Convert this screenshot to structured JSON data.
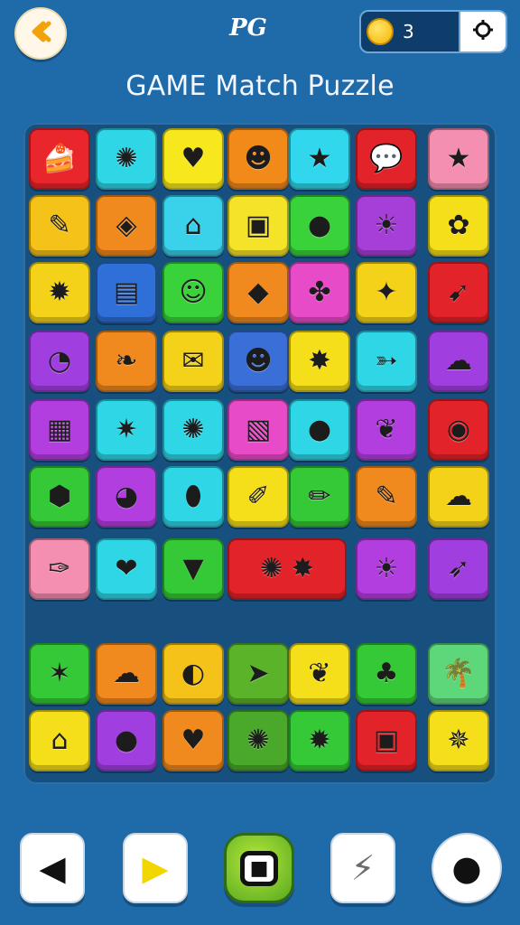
{
  "header": {
    "level": "PG",
    "coins": "3",
    "title": "GAME Match Puzzle"
  },
  "icons": {
    "back": "back-arrow-icon",
    "settings": "gear-icon",
    "coin": "coin-icon"
  },
  "toolbar": [
    {
      "name": "previous-button",
      "icon": "left-triangle-icon",
      "glyph": "◀",
      "color": "#111111"
    },
    {
      "name": "play-button",
      "icon": "play-icon",
      "glyph": "▶",
      "color": "#f2d600"
    },
    {
      "name": "center-action-button",
      "icon": "square-target-icon",
      "glyph": "■",
      "color": "#111111"
    },
    {
      "name": "wand-button",
      "icon": "wand-icon",
      "glyph": "⚡",
      "color": "#6b6b6b"
    },
    {
      "name": "bomb-button",
      "icon": "bomb-icon",
      "glyph": "●",
      "color": "#111111"
    }
  ],
  "tiles": [
    [
      {
        "bg": "#e8262b",
        "icon": "cake-icon",
        "glyph": "🍰"
      },
      {
        "bg": "#2fd6e6",
        "icon": "green-monster-icon",
        "glyph": "✺"
      },
      {
        "bg": "#f7e81e",
        "icon": "heart-icon",
        "glyph": "♥"
      },
      {
        "bg": "#f28a1a",
        "icon": "purple-face-icon",
        "glyph": "☻"
      },
      {
        "bg": "#31d7ec",
        "icon": "purple-star-icon",
        "glyph": "★"
      },
      {
        "bg": "#e3232a",
        "icon": "chat-bubble-icon",
        "glyph": "💬"
      },
      {
        "bg": "#f58fb1",
        "icon": "gold-star-icon",
        "glyph": "★"
      }
    ],
    [
      {
        "bg": "#f5c21a",
        "icon": "sock-icon",
        "glyph": "✎"
      },
      {
        "bg": "#f08a1e",
        "icon": "window-icon",
        "glyph": "◈"
      },
      {
        "bg": "#3ad2ea",
        "icon": "temple-icon",
        "glyph": "⌂"
      },
      {
        "bg": "#f5e32a",
        "icon": "robot-icon",
        "glyph": "▣"
      },
      {
        "bg": "#3ad23a",
        "icon": "orange-fruit-icon",
        "glyph": "●"
      },
      {
        "bg": "#a63ed8",
        "icon": "sun-icon",
        "glyph": "☀"
      },
      {
        "bg": "#f5de1a",
        "icon": "green-star-icon",
        "glyph": "✿"
      }
    ],
    [
      {
        "bg": "#f5d21a",
        "icon": "purple-sun-icon",
        "glyph": "✹"
      },
      {
        "bg": "#2f6fd8",
        "icon": "chest-icon",
        "glyph": "▤"
      },
      {
        "bg": "#3ad23a",
        "icon": "orange-face-icon",
        "glyph": "☺"
      },
      {
        "bg": "#f08a1e",
        "icon": "blue-leaf-icon",
        "glyph": "◆"
      },
      {
        "bg": "#e84bc8",
        "icon": "green-blob-icon",
        "glyph": "✤"
      },
      {
        "bg": "#f5d21a",
        "icon": "creature-icon",
        "glyph": "✦"
      },
      {
        "bg": "#e3232a",
        "icon": "compass-icon",
        "glyph": "➹"
      }
    ],
    [
      {
        "bg": "#a13ee0",
        "icon": "speech-bubble-icon",
        "glyph": "◔"
      },
      {
        "bg": "#f08a1e",
        "icon": "leaf-icon",
        "glyph": "❧"
      },
      {
        "bg": "#f5d21a",
        "icon": "envelope-icon",
        "glyph": "✉"
      },
      {
        "bg": "#3a6fd8",
        "icon": "carrot-face-icon",
        "glyph": "☻"
      },
      {
        "bg": "#f5de1a",
        "icon": "pink-flower-icon",
        "glyph": "✸"
      },
      {
        "bg": "#2fd6e6",
        "icon": "carrot-icon",
        "glyph": "➳"
      },
      {
        "bg": "#a13ee0",
        "icon": "cat-cloud-icon",
        "glyph": "☁"
      }
    ],
    [
      {
        "bg": "#b23ee0",
        "icon": "radio-icon",
        "glyph": "▦"
      },
      {
        "bg": "#2fd6e6",
        "icon": "star-badge-icon",
        "glyph": "✷"
      },
      {
        "bg": "#2fd6e6",
        "icon": "cookie-icon",
        "glyph": "✺"
      },
      {
        "bg": "#e84bc8",
        "icon": "cube-icon",
        "glyph": "▧"
      },
      {
        "bg": "#2fd6e6",
        "icon": "balloon-icon",
        "glyph": "●"
      },
      {
        "bg": "#b23ee0",
        "icon": "radish-icon",
        "glyph": "❦"
      },
      {
        "bg": "#e3232a",
        "icon": "eye-icon",
        "glyph": "◉"
      }
    ],
    [
      {
        "bg": "#35c837",
        "icon": "bag-icon",
        "glyph": "⬢"
      },
      {
        "bg": "#b23ee0",
        "icon": "chick-icon",
        "glyph": "◕"
      },
      {
        "bg": "#2fd6e6",
        "icon": "plum-icon",
        "glyph": "⬮"
      },
      {
        "bg": "#f5de1a",
        "icon": "brush-icon",
        "glyph": "✐"
      },
      {
        "bg": "#35c837",
        "icon": "pencil-icon",
        "glyph": "✏"
      },
      {
        "bg": "#f08a1e",
        "icon": "notebook-icon",
        "glyph": "✎"
      },
      {
        "bg": "#f5d21a",
        "icon": "cloud-icon",
        "glyph": "☁"
      }
    ],
    [
      {
        "bg": "#f58fb1",
        "icon": "paint-tube-icon",
        "glyph": "✑"
      },
      {
        "bg": "#2fd6e6",
        "icon": "berry-icon",
        "glyph": "❤"
      },
      {
        "bg": "#35c837",
        "icon": "watermelon-icon",
        "glyph": "▼"
      },
      {
        "bg": "#e3232a",
        "icon": "shell-fish-icon",
        "glyph": "✺ ✸",
        "wide": true
      },
      {
        "bg": "#b23ee0",
        "icon": "sun-face-icon",
        "glyph": "☀"
      },
      {
        "bg": "#a13ee0",
        "icon": "rocket-icon",
        "glyph": "➶"
      }
    ],
    [
      {
        "bg": "#35c837",
        "icon": "starfish-icon",
        "glyph": "✶"
      },
      {
        "bg": "#f08a1e",
        "icon": "cloud-bubble-icon",
        "glyph": "☁"
      },
      {
        "bg": "#f5c21a",
        "icon": "mango-icon",
        "glyph": "◐"
      },
      {
        "bg": "#5bb32a",
        "icon": "fish-rocket-icon",
        "glyph": "➤"
      },
      {
        "bg": "#f5de1a",
        "icon": "lemon-leaf-icon",
        "glyph": "❦"
      },
      {
        "bg": "#35c837",
        "icon": "tree-icon",
        "glyph": "♣"
      },
      {
        "bg": "#5ed67a",
        "icon": "palm-tree-icon",
        "glyph": "🌴"
      }
    ],
    [
      {
        "bg": "#f5de1a",
        "icon": "museum-icon",
        "glyph": "⌂"
      },
      {
        "bg": "#a13ee0",
        "icon": "lemon-icon",
        "glyph": "●"
      },
      {
        "bg": "#f08a1e",
        "icon": "red-heart-icon",
        "glyph": "♥"
      },
      {
        "bg": "#4aa82a",
        "icon": "blue-flower-icon",
        "glyph": "✺"
      },
      {
        "bg": "#35c837",
        "icon": "orange-flower-icon",
        "glyph": "✹"
      },
      {
        "bg": "#e3232a",
        "icon": "lunchbox-icon",
        "glyph": "▣"
      },
      {
        "bg": "#f5de1a",
        "icon": "beetle-icon",
        "glyph": "✵"
      }
    ]
  ]
}
